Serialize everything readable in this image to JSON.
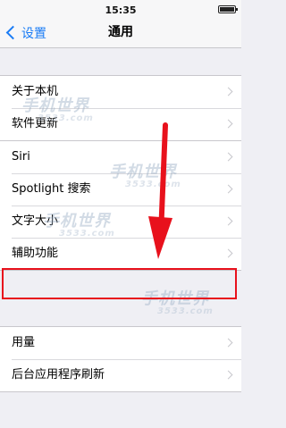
{
  "status_bar": {
    "time": "15:35"
  },
  "nav": {
    "back_label": "设置",
    "title": "通用"
  },
  "groups": [
    {
      "items": [
        {
          "label": "关于本机"
        },
        {
          "label": "软件更新"
        }
      ]
    },
    {
      "items": [
        {
          "label": "Siri"
        },
        {
          "label": "Spotlight 搜索"
        },
        {
          "label": "文字大小"
        },
        {
          "label": "辅助功能",
          "highlighted": true
        }
      ]
    },
    {
      "items": [
        {
          "label": "用量"
        },
        {
          "label": "后台应用程序刷新"
        }
      ]
    }
  ],
  "annotation": {
    "arrow_color": "#e8111c",
    "highlight_color": "#e8111c"
  },
  "watermark": {
    "brand": "手机世界",
    "site": "3533.com"
  },
  "colors": {
    "accent": "#1a7cf5",
    "background": "#efeff4"
  }
}
